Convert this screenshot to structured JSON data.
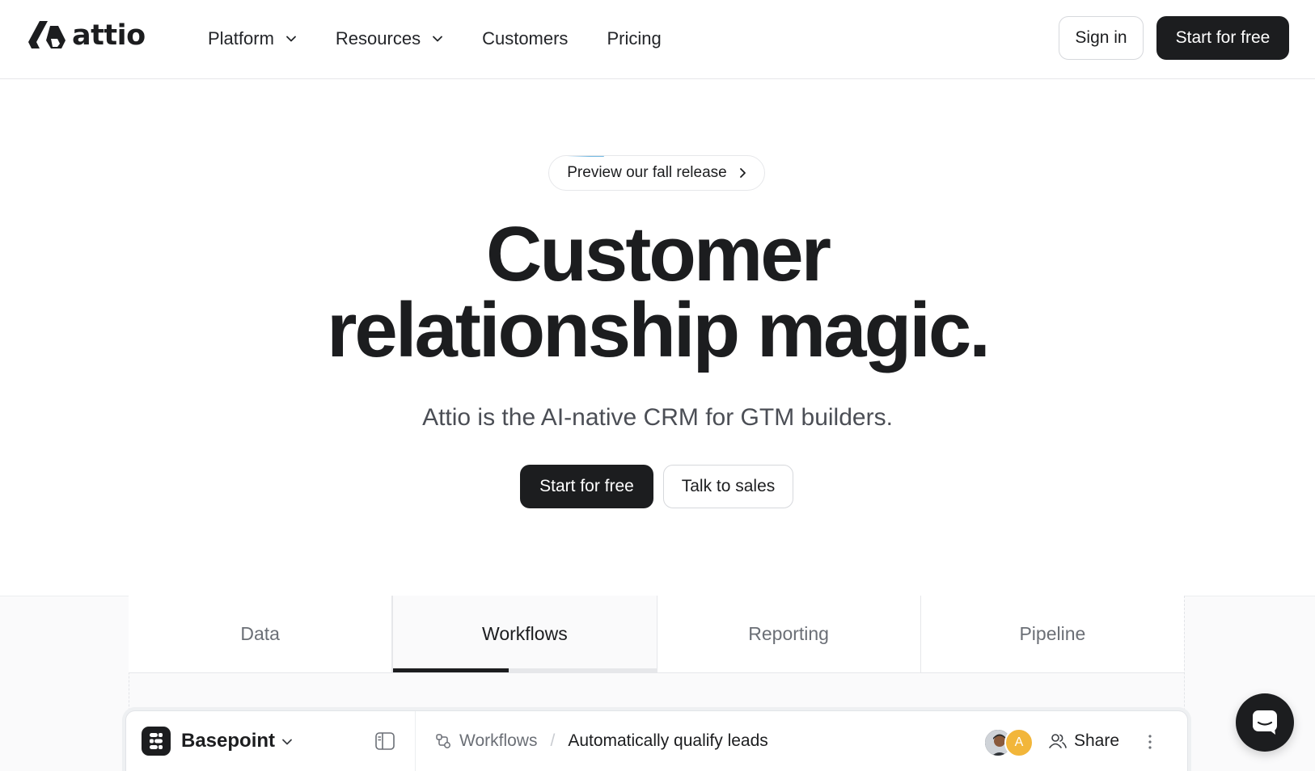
{
  "header": {
    "logo_text": "attio",
    "nav": [
      {
        "label": "Platform",
        "has_dropdown": true
      },
      {
        "label": "Resources",
        "has_dropdown": true
      },
      {
        "label": "Customers",
        "has_dropdown": false
      },
      {
        "label": "Pricing",
        "has_dropdown": false
      }
    ],
    "signin_label": "Sign in",
    "start_label": "Start for free"
  },
  "hero": {
    "announcement": "Preview our fall release",
    "title_line1": "Customer",
    "title_line2": "relationship magic.",
    "subtitle": "Attio is the AI-native CRM for GTM builders.",
    "primary_cta": "Start for free",
    "secondary_cta": "Talk to sales"
  },
  "tabs": {
    "items": [
      {
        "label": "Data",
        "active": false
      },
      {
        "label": "Workflows",
        "active": true,
        "progress": 0.44
      },
      {
        "label": "Reporting",
        "active": false
      },
      {
        "label": "Pipeline",
        "active": false
      }
    ]
  },
  "app_preview": {
    "workspace_name": "Basepoint",
    "breadcrumb_section": "Workflows",
    "breadcrumb_page": "Automatically qualify leads",
    "avatar_initial": "A",
    "share_label": "Share"
  },
  "colors": {
    "primary_dark": "#1c1d1f",
    "muted_text": "#6b6f76",
    "border": "#e6e7ea",
    "avatar_accent": "#f2b63a"
  },
  "icons": [
    "logo-mark",
    "chevron-down-icon",
    "chevron-right-icon",
    "workspace-logo-icon",
    "sidebar-toggle-icon",
    "workflow-icon",
    "users-icon",
    "more-vertical-icon",
    "chat-icon"
  ]
}
